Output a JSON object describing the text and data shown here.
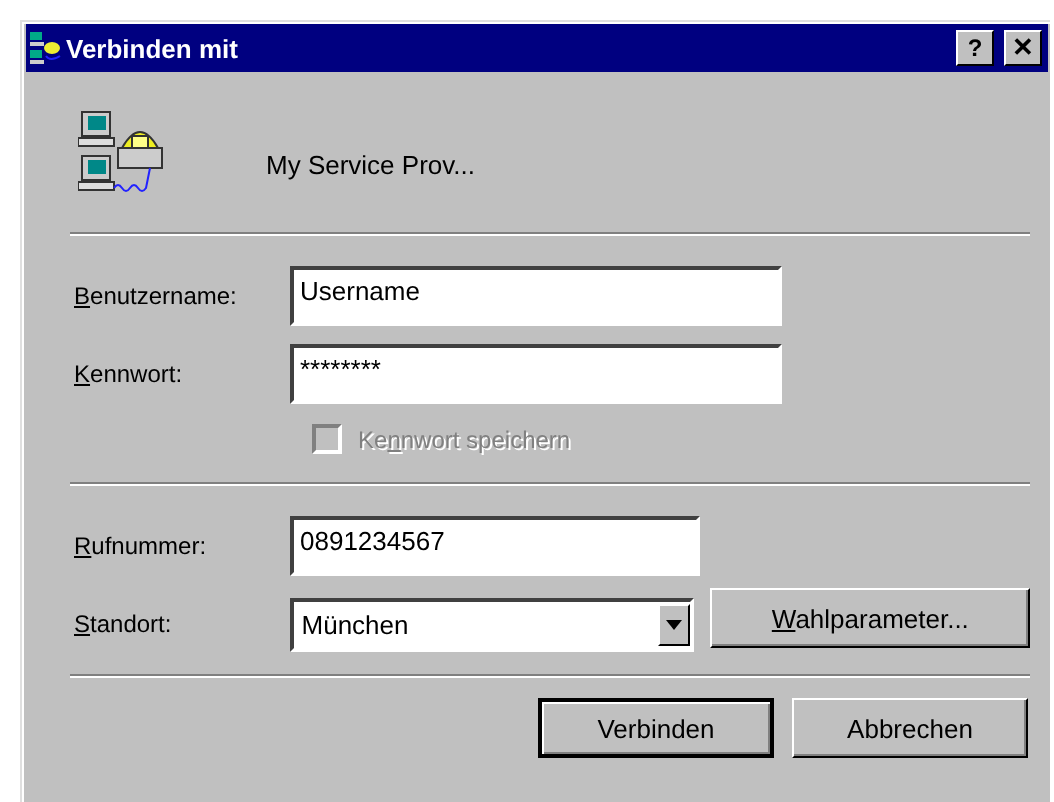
{
  "window": {
    "title": "Verbinden mit",
    "title_buttons": [
      {
        "kind": "help",
        "label": "?"
      },
      {
        "kind": "close",
        "label": "✕"
      }
    ]
  },
  "connection": {
    "name": "My Service Prov..."
  },
  "fields": [
    {
      "kind": "text",
      "label": {
        "key": "B",
        "after": "enutzername:"
      },
      "value": "Username"
    },
    {
      "kind": "text",
      "label": {
        "key": "K",
        "after": "ennwort:"
      },
      "value": "********"
    }
  ],
  "save_password": {
    "label": {
      "before": "Ke",
      "key": "n",
      "after": "nwort speichern"
    },
    "checked": false,
    "disabled": true
  },
  "dial_fields": [
    {
      "kind": "text",
      "label": {
        "key": "R",
        "after": "ufnummer:"
      },
      "value": "0891234567"
    },
    {
      "kind": "combo",
      "label": {
        "key": "S",
        "after": "tandort:"
      },
      "value": "München",
      "button": {
        "label": {
          "key": "W",
          "after": "ahlparameter..."
        }
      }
    }
  ],
  "buttons": [
    {
      "label": "Verbinden",
      "default": true
    },
    {
      "label": "Abbrechen",
      "default": false
    }
  ]
}
